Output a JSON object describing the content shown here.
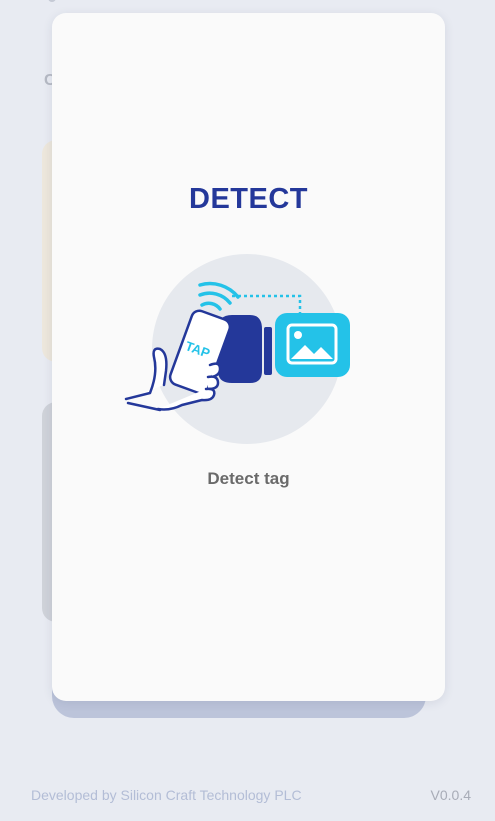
{
  "modal": {
    "title": "DETECT",
    "caption": "Detect tag",
    "illustration": {
      "phone_text": "TAP",
      "icons": [
        "hand-holding-phone-icon",
        "nfc-signal-icon",
        "nfc-reader-icon",
        "image-icon"
      ]
    }
  },
  "background": {
    "heading_partial": "C"
  },
  "footer": {
    "developer": "Developed by Silicon Craft Technology PLC",
    "version": "V0.0.4"
  },
  "colors": {
    "title": "#24389a",
    "accent_cyan": "#24c2e8",
    "navy": "#24389a",
    "circle_bg": "#e6e9ee"
  }
}
